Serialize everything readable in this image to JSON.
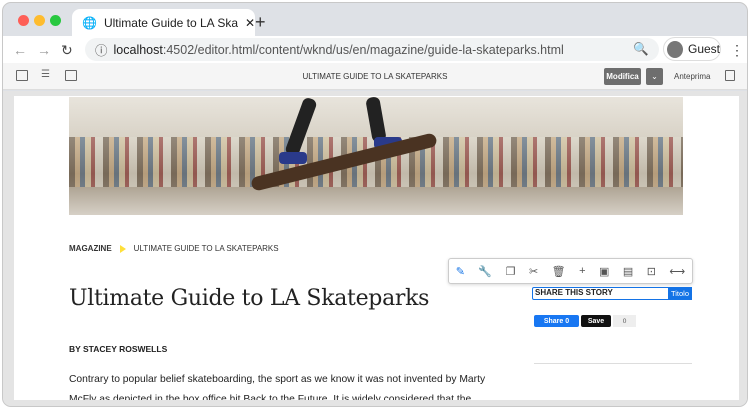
{
  "browser": {
    "tab_title": "Ultimate Guide to LA Skateparks",
    "url_host": "localhost",
    "url_rest": ":4502/editor.html/content/wknd/us/en/magazine/guide-la-skateparks.html",
    "profile": "Guest"
  },
  "editor": {
    "page_title": "ULTIMATE GUIDE TO LA SKATEPARKS",
    "mode_button": "Modifica",
    "preview": "Anteprima"
  },
  "article": {
    "breadcrumb": [
      "MAGAZINE",
      "ULTIMATE GUIDE TO LA SKATEPARKS"
    ],
    "title": "Ultimate Guide to LA Skateparks",
    "byline": "BY STACEY ROSWELLS",
    "paragraph": "Contrary to popular belief skateboarding, the sport as we know it was not invented by Marty McFly as depicted in the box office hit Back to the Future. It is widely considered that the"
  },
  "component": {
    "text": "SHARE THIS STORY",
    "label": "Titolo"
  },
  "social": {
    "facebook": "Share 0",
    "pinterest": "Save",
    "count": "0"
  }
}
